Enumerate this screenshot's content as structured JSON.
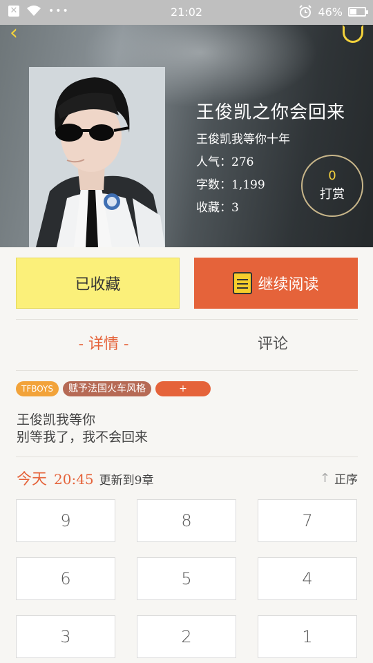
{
  "status_bar": {
    "time": "21:02",
    "battery": "46%",
    "battery_level": 0.46
  },
  "book": {
    "title": "王俊凯之你会回来",
    "subtitle": "王俊凯我等你十年",
    "popularity_label": "人气：",
    "popularity": "276",
    "words_label": "字数：",
    "words": "1,199",
    "favorites_label": "收藏：",
    "favorites": "3"
  },
  "tip": {
    "count": "0",
    "label": "打赏"
  },
  "actions": {
    "favorited_label": "已收藏",
    "continue_label": "继续阅读"
  },
  "tabs": [
    {
      "label": "- 详情 -"
    },
    {
      "label": "评论"
    }
  ],
  "tags": [
    {
      "label": "TFBOYS"
    },
    {
      "label": "赋予法国火车风格"
    },
    {
      "label": "+"
    }
  ],
  "description": {
    "line1": "王俊凯我等你",
    "line2": "别等我了，我不会回来"
  },
  "update": {
    "day": "今天",
    "time": "20:45",
    "text": "更新到9章",
    "sort_label": "正序"
  },
  "chapters": [
    "9",
    "8",
    "7",
    "6",
    "5",
    "4",
    "3",
    "2",
    "1"
  ],
  "colors": {
    "accent": "#e5633a",
    "favorite_bg": "#fbf07a",
    "tip_count": "#f5d23e",
    "nav_icon": "#f3d23b"
  }
}
